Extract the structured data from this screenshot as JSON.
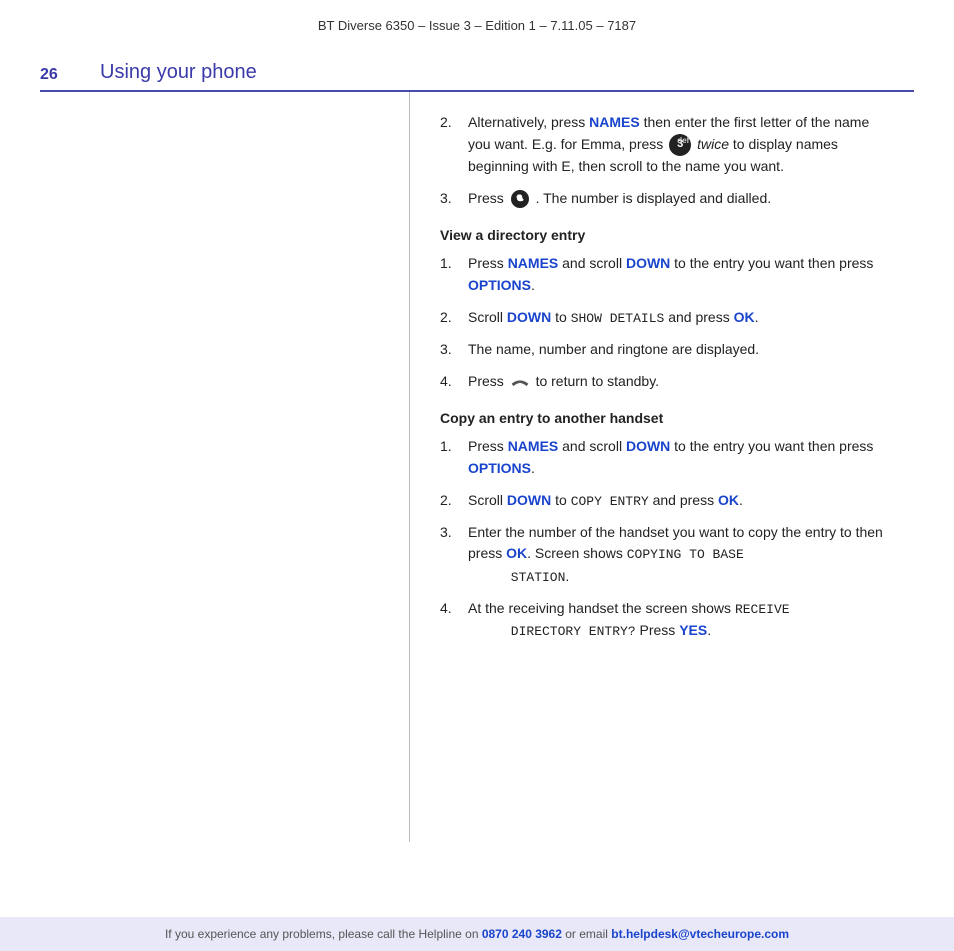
{
  "header": {
    "text": "BT Diverse 6350 – Issue 3 – Edition 1 – 7.11.05 – 7187"
  },
  "section": {
    "number": "26",
    "title": "Using your phone"
  },
  "content": {
    "step2_intro": "Alternatively, press ",
    "step2_names": "NAMES",
    "step2_middle": " then enter the first letter of the name you want. E.g. for Emma, press ",
    "step2_key": "3",
    "step2_italic": " twice",
    "step2_end": " to display names beginning with E, then scroll to the name you want.",
    "step3_start": "Press ",
    "step3_end": ". The number is displayed and dialled.",
    "view_heading": "View a directory entry",
    "view_s1_start": "Press ",
    "view_s1_names": "NAMES",
    "view_s1_middle": " and scroll ",
    "view_s1_down": "DOWN",
    "view_s1_end": " to the entry you want then press ",
    "view_s1_options": "OPTIONS",
    "view_s1_dot": ".",
    "view_s2_start": "Scroll ",
    "view_s2_down": "DOWN",
    "view_s2_middle": " to ",
    "view_s2_mono": "SHOW DETAILS",
    "view_s2_end": " and press ",
    "view_s2_ok": "OK",
    "view_s2_dot": ".",
    "view_s3": "The name, number and ringtone are displayed.",
    "view_s4_start": "Press ",
    "view_s4_end": " to return to standby.",
    "copy_heading": "Copy an entry to another handset",
    "copy_s1_start": "Press ",
    "copy_s1_names": "NAMES",
    "copy_s1_middle": " and scroll ",
    "copy_s1_down": "DOWN",
    "copy_s1_end": " to the entry you want then press ",
    "copy_s1_options": "OPTIONS",
    "copy_s1_dot": ".",
    "copy_s2_start": "Scroll ",
    "copy_s2_down": "DOWN",
    "copy_s2_middle": " to ",
    "copy_s2_mono": "COPY ENTRY",
    "copy_s2_end": " and press ",
    "copy_s2_ok": "OK",
    "copy_s2_dot": ".",
    "copy_s3_start": "Enter the number of the handset you want to copy the entry to then press ",
    "copy_s3_ok": "OK",
    "copy_s3_middle": ". Screen shows ",
    "copy_s3_mono1": "COPYING TO BASE",
    "copy_s3_mono2": "STATION",
    "copy_s3_dot": ".",
    "copy_s4_start": "At the receiving handset the screen shows ",
    "copy_s4_mono1": "RECEIVE",
    "copy_s4_mono2": "DIRECTORY ENTRY?",
    "copy_s4_middle": " Press ",
    "copy_s4_yes": "YES",
    "copy_s4_dot": ".",
    "footer": {
      "text_start": "If you experience any problems, please call the Helpline on ",
      "phone": "0870 240 3962",
      "text_mid": " or email ",
      "email": "bt.helpdesk@vtecheurope.com"
    }
  }
}
